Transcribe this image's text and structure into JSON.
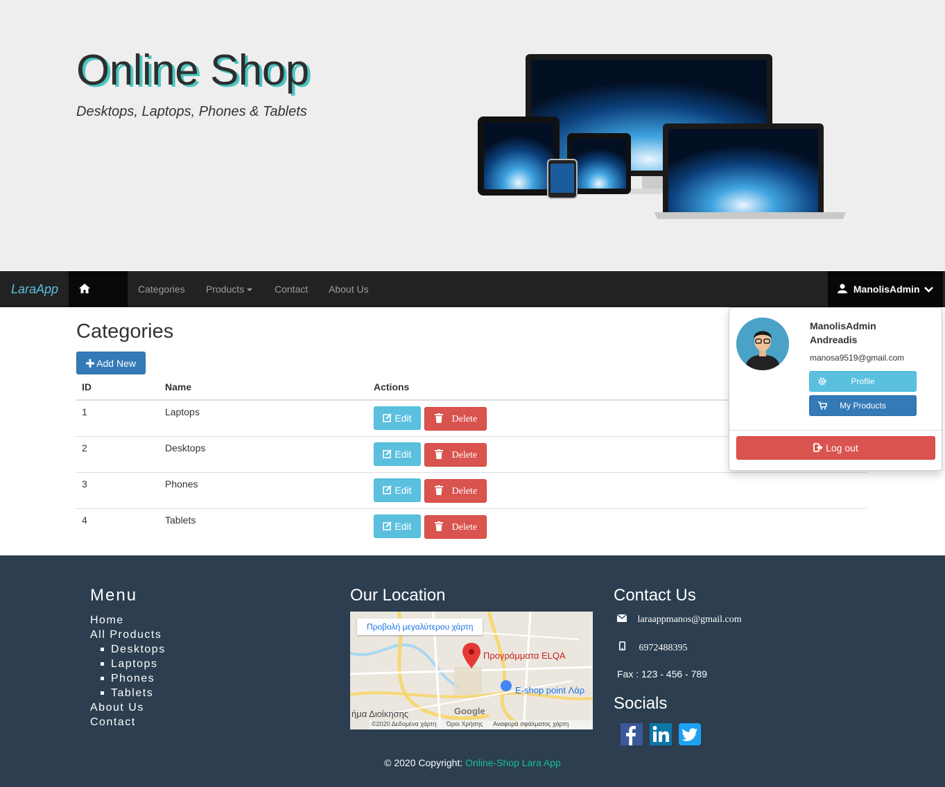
{
  "hero": {
    "title": "Online Shop",
    "subtitle": "Desktops, Laptops, Phones & Tablets"
  },
  "navbar": {
    "brand": "LaraApp",
    "items": [
      {
        "label": "Home",
        "icon": "home-icon"
      },
      {
        "label": "Categories"
      },
      {
        "label": "Products",
        "icon": "caret-down-icon"
      },
      {
        "label": "Contact"
      },
      {
        "label": "About Us"
      }
    ],
    "user": "ManolisAdmin"
  },
  "main": {
    "title": "Categories",
    "add_label": "Add New",
    "columns": [
      "ID",
      "Name",
      "Actions"
    ],
    "rows": [
      {
        "id": "1",
        "name": "Laptops"
      },
      {
        "id": "2",
        "name": "Desktops"
      },
      {
        "id": "3",
        "name": "Phones"
      },
      {
        "id": "4",
        "name": "Tablets"
      }
    ],
    "edit_label": "Edit",
    "delete_label": "Delete"
  },
  "dropdown": {
    "name_line1": "ManolisAdmin",
    "name_line2": "Andreadis",
    "email": "manosa9519@gmail.com",
    "profile_label": "Profile",
    "my_products_label": "My Products",
    "logout_label": "Log out"
  },
  "footer": {
    "menu_title": "Menu",
    "menu": {
      "home": "Home",
      "all_products": "All Products",
      "sub": [
        "Desktops",
        "Laptops",
        "Phones",
        "Tablets"
      ],
      "about": "About Us",
      "contact": "Contact"
    },
    "location_title": "Our Location",
    "map": {
      "view_larger": "Προβολή μεγαλύτερου χάρτη",
      "pin1": "Προγράμματα ELQA",
      "pin2": "E-shop point Λάρ",
      "area": "ήμα Διοίκησης",
      "attribution": "©2020 Δεδομένα χάρτη",
      "terms": "Όροι Χρήσης",
      "report": "Αναφορά σφάλματος χάρτη",
      "logo": "Google"
    },
    "contact_title": "Contact Us",
    "email": "laraappmanos@gmail.com",
    "phone": "6972488395",
    "fax": "Fax : 123 - 456 - 789",
    "socials_title": "Socials",
    "copyright_prefix": "© 2020 Copyright: ",
    "copyright_link": "Online-Shop Lara App"
  },
  "colors": {
    "primary": "#337ab7",
    "info": "#5bc0de",
    "danger": "#d9534f",
    "navbar": "#222222",
    "footer": "#2c3e50",
    "accent": "#1abc9c"
  }
}
